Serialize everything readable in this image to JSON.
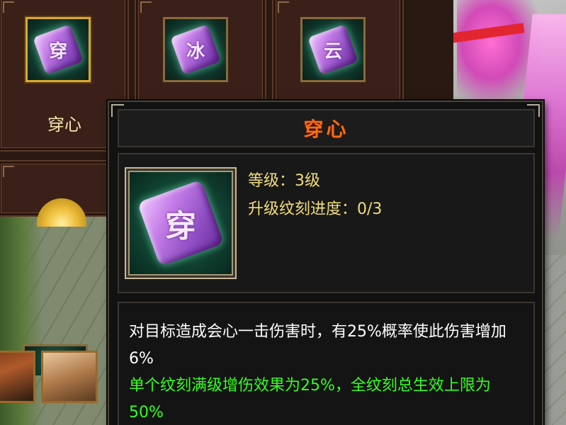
{
  "skill_panel": {
    "slots": [
      {
        "glyph": "穿",
        "label": "穿心",
        "selected": true
      },
      {
        "glyph": "冰",
        "label": "",
        "selected": false
      },
      {
        "glyph": "云",
        "label": "",
        "selected": false
      }
    ]
  },
  "tooltip": {
    "title": "穿心",
    "icon_glyph": "穿",
    "level_line": "等级：3级",
    "progress_line": "升级纹刻进度：0/3",
    "description": "对目标造成会心一击伤害时，有25%概率使此伤害增加6%",
    "bonus_text": "单个纹刻满级增伤效果为25%，全纹刻总生效上限为50%"
  },
  "colors": {
    "title": "#ff6a10",
    "stats": "#f2de7a",
    "description": "#ffffff",
    "bonus": "#34ff20",
    "selected_border": "#d9a832"
  }
}
